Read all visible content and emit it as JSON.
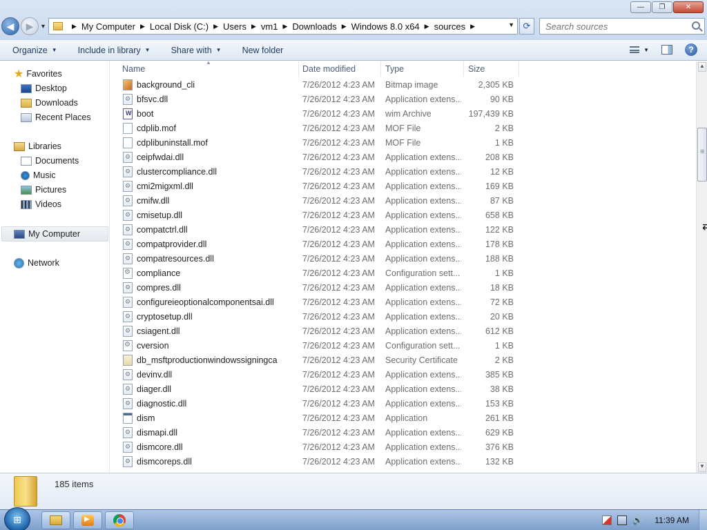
{
  "window": {
    "minimize_glyph": "—",
    "restore_glyph": "❐",
    "close_glyph": "✕"
  },
  "address": {
    "crumbs": [
      "My Computer",
      "Local Disk (C:)",
      "Users",
      "vm1",
      "Downloads",
      "Windows 8.0 x64",
      "sources"
    ]
  },
  "search": {
    "placeholder": "Search sources"
  },
  "toolbar": {
    "organize": "Organize",
    "include_in_library": "Include in library",
    "share_with": "Share with",
    "new_folder": "New folder",
    "help_glyph": "?"
  },
  "navpane": {
    "favorites": "Favorites",
    "desktop": "Desktop",
    "downloads": "Downloads",
    "recent_places": "Recent Places",
    "libraries": "Libraries",
    "documents": "Documents",
    "music": "Music",
    "pictures": "Pictures",
    "videos": "Videos",
    "my_computer": "My Computer",
    "network": "Network"
  },
  "columns": {
    "name": "Name",
    "date": "Date modified",
    "type": "Type",
    "size": "Size"
  },
  "files": [
    {
      "name": "background_cli",
      "date": "7/26/2012 4:23 AM",
      "type": "Bitmap image",
      "size": "2,305 KB",
      "icon": "image-icon"
    },
    {
      "name": "bfsvc.dll",
      "date": "7/26/2012 4:23 AM",
      "type": "Application extens...",
      "size": "90 KB",
      "icon": "dll-icon"
    },
    {
      "name": "boot",
      "date": "7/26/2012 4:23 AM",
      "type": "wim Archive",
      "size": "197,439 KB",
      "icon": "archive-icon"
    },
    {
      "name": "cdplib.mof",
      "date": "7/26/2012 4:23 AM",
      "type": "MOF File",
      "size": "2 KB",
      "icon": "file-icon"
    },
    {
      "name": "cdplibuninstall.mof",
      "date": "7/26/2012 4:23 AM",
      "type": "MOF File",
      "size": "1 KB",
      "icon": "file-icon"
    },
    {
      "name": "ceipfwdai.dll",
      "date": "7/26/2012 4:23 AM",
      "type": "Application extens...",
      "size": "208 KB",
      "icon": "dll-icon"
    },
    {
      "name": "clustercompliance.dll",
      "date": "7/26/2012 4:23 AM",
      "type": "Application extens...",
      "size": "12 KB",
      "icon": "dll-icon"
    },
    {
      "name": "cmi2migxml.dll",
      "date": "7/26/2012 4:23 AM",
      "type": "Application extens...",
      "size": "169 KB",
      "icon": "dll-icon"
    },
    {
      "name": "cmifw.dll",
      "date": "7/26/2012 4:23 AM",
      "type": "Application extens...",
      "size": "87 KB",
      "icon": "dll-icon"
    },
    {
      "name": "cmisetup.dll",
      "date": "7/26/2012 4:23 AM",
      "type": "Application extens...",
      "size": "658 KB",
      "icon": "dll-icon"
    },
    {
      "name": "compatctrl.dll",
      "date": "7/26/2012 4:23 AM",
      "type": "Application extens...",
      "size": "122 KB",
      "icon": "dll-icon"
    },
    {
      "name": "compatprovider.dll",
      "date": "7/26/2012 4:23 AM",
      "type": "Application extens...",
      "size": "178 KB",
      "icon": "dll-icon"
    },
    {
      "name": "compatresources.dll",
      "date": "7/26/2012 4:23 AM",
      "type": "Application extens...",
      "size": "188 KB",
      "icon": "dll-icon"
    },
    {
      "name": "compliance",
      "date": "7/26/2012 4:23 AM",
      "type": "Configuration sett...",
      "size": "1 KB",
      "icon": "config-icon"
    },
    {
      "name": "compres.dll",
      "date": "7/26/2012 4:23 AM",
      "type": "Application extens...",
      "size": "18 KB",
      "icon": "dll-icon"
    },
    {
      "name": "configureieoptionalcomponentsai.dll",
      "date": "7/26/2012 4:23 AM",
      "type": "Application extens...",
      "size": "72 KB",
      "icon": "dll-icon"
    },
    {
      "name": "cryptosetup.dll",
      "date": "7/26/2012 4:23 AM",
      "type": "Application extens...",
      "size": "20 KB",
      "icon": "dll-icon"
    },
    {
      "name": "csiagent.dll",
      "date": "7/26/2012 4:23 AM",
      "type": "Application extens...",
      "size": "612 KB",
      "icon": "dll-icon"
    },
    {
      "name": "cversion",
      "date": "7/26/2012 4:23 AM",
      "type": "Configuration sett...",
      "size": "1 KB",
      "icon": "config-icon"
    },
    {
      "name": "db_msftproductionwindowssigningca",
      "date": "7/26/2012 4:23 AM",
      "type": "Security Certificate",
      "size": "2 KB",
      "icon": "certificate-icon"
    },
    {
      "name": "devinv.dll",
      "date": "7/26/2012 4:23 AM",
      "type": "Application extens...",
      "size": "385 KB",
      "icon": "dll-icon"
    },
    {
      "name": "diager.dll",
      "date": "7/26/2012 4:23 AM",
      "type": "Application extens...",
      "size": "38 KB",
      "icon": "dll-icon"
    },
    {
      "name": "diagnostic.dll",
      "date": "7/26/2012 4:23 AM",
      "type": "Application extens...",
      "size": "153 KB",
      "icon": "dll-icon"
    },
    {
      "name": "dism",
      "date": "7/26/2012 4:23 AM",
      "type": "Application",
      "size": "261 KB",
      "icon": "application-icon"
    },
    {
      "name": "dismapi.dll",
      "date": "7/26/2012 4:23 AM",
      "type": "Application extens...",
      "size": "629 KB",
      "icon": "dll-icon"
    },
    {
      "name": "dismcore.dll",
      "date": "7/26/2012 4:23 AM",
      "type": "Application extens...",
      "size": "376 KB",
      "icon": "dll-icon"
    },
    {
      "name": "dismcoreps.dll",
      "date": "7/26/2012 4:23 AM",
      "type": "Application extens...",
      "size": "132 KB",
      "icon": "dll-icon"
    }
  ],
  "details": {
    "items_count": "185 items"
  },
  "taskbar": {
    "clock": "11:39 AM",
    "start_glyph": "⊞",
    "volume_glyph": "🔊"
  },
  "cursor_glyph": "⇄"
}
